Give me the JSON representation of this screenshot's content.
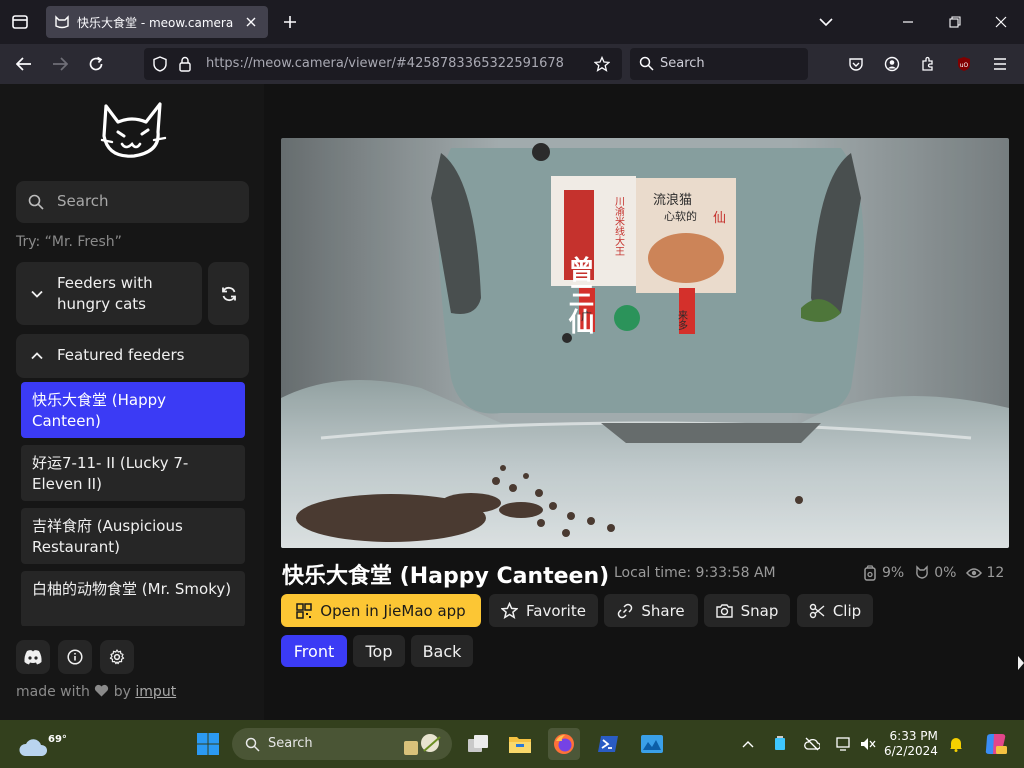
{
  "browser": {
    "tab_title": "快乐大食堂 - meow.camera",
    "url_host": "https://meow.camera",
    "url_path": "/viewer/#4258783365322591678",
    "search_placeholder": "Search"
  },
  "sidebar": {
    "search_placeholder": "Search",
    "hint": "Try: “Mr. Fresh”",
    "hungry_panel_label": "Feeders with hungry cats",
    "featured_panel_label": "Featured feeders",
    "feeders": [
      {
        "label": "快乐大食堂 (Happy Canteen)",
        "active": true
      },
      {
        "label": "好运7-11- II (Lucky 7-Eleven II)",
        "active": false
      },
      {
        "label": "吉祥食府 (Auspicious Restaurant)",
        "active": false
      },
      {
        "label": "白柚的动物食堂 (Mr. Smoky)",
        "active": false
      }
    ],
    "credit_prefix": "made with",
    "credit_by": "by",
    "credit_link": "imput"
  },
  "main": {
    "title": "快乐大食堂 (Happy Canteen)",
    "local_time_label": "Local time:",
    "local_time": "9:33:58 AM",
    "stats": {
      "food": "9%",
      "cat": "0%",
      "viewers": "12"
    },
    "video_text": {
      "sign_left": "曾三仙",
      "sign_left_sub": "川渝米线大王",
      "sign_right_top": "流浪猫",
      "sign_right_sub": "心软的",
      "sign_right_seal": "仙",
      "tag_left": "广",
      "tag_right": "来多"
    },
    "actions": [
      {
        "label": "Open in JieMao app",
        "icon": "qr-icon"
      },
      {
        "label": "Favorite",
        "icon": "star-icon"
      },
      {
        "label": "Share",
        "icon": "link-icon"
      },
      {
        "label": "Snap",
        "icon": "camera-icon"
      },
      {
        "label": "Clip",
        "icon": "scissors-icon"
      }
    ],
    "views": [
      {
        "label": "Front",
        "active": true
      },
      {
        "label": "Top",
        "active": false
      },
      {
        "label": "Back",
        "active": false
      }
    ]
  },
  "taskbar": {
    "weather_temp": "69°",
    "search_label": "Search",
    "time": "6:33 PM",
    "date": "6/2/2024"
  },
  "colors": {
    "accent": "#3b3bf5",
    "primary_button": "#fcc634",
    "taskbar": "#33401d"
  }
}
